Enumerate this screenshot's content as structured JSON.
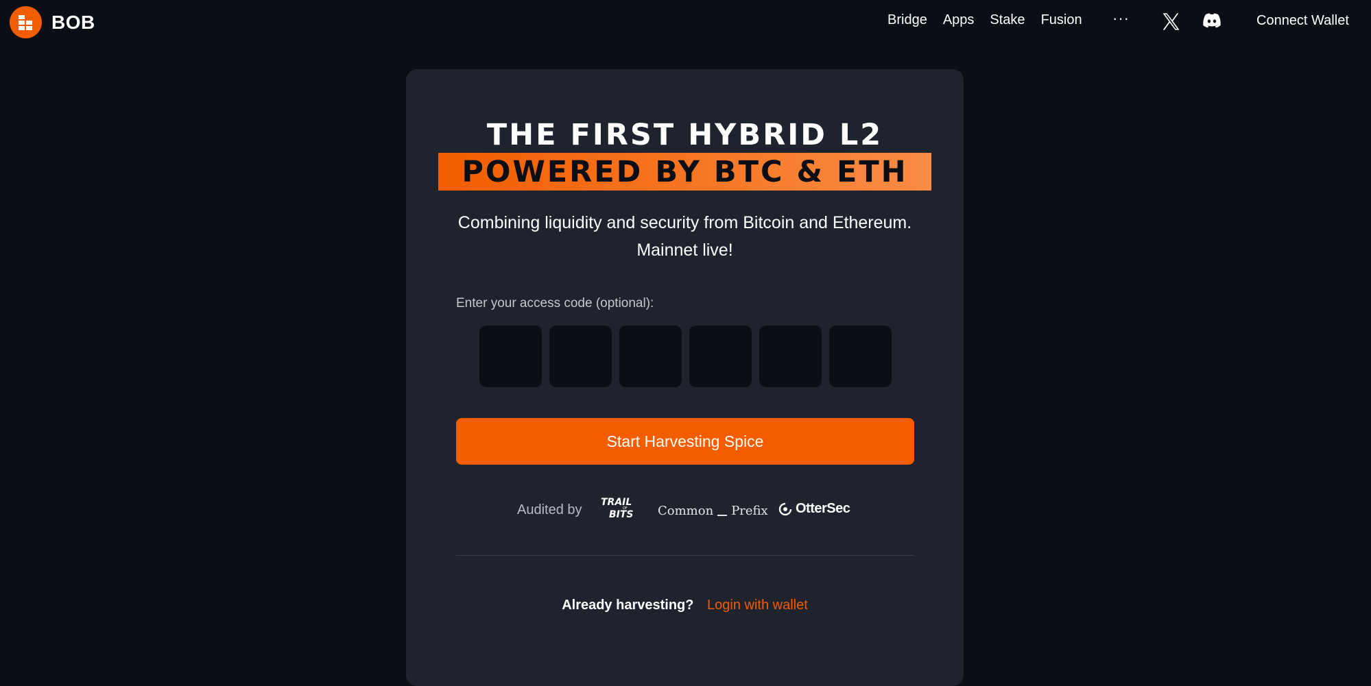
{
  "brand": {
    "name": "BOB"
  },
  "nav": {
    "items": [
      {
        "label": "Bridge"
      },
      {
        "label": "Apps"
      },
      {
        "label": "Stake"
      },
      {
        "label": "Fusion"
      }
    ],
    "more_label": "···",
    "connect_wallet_label": "Connect Wallet"
  },
  "hero": {
    "headline_line1": "THE FIRST HYBRID L2",
    "headline_line2": "POWERED BY BTC & ETH",
    "subtitle_line1": "Combining liquidity and security from Bitcoin and Ethereum.",
    "subtitle_line2": "Mainnet live!"
  },
  "access_code": {
    "label": "Enter your access code (optional):",
    "boxes": [
      "",
      "",
      "",
      "",
      "",
      ""
    ]
  },
  "cta": {
    "label": "Start Harvesting Spice"
  },
  "audits": {
    "label": "Audited by",
    "trail_of_bits": "TRAIL OF BITS",
    "common_prefix_left": "Common",
    "common_prefix_right": "Prefix",
    "ottersec": "OtterSec"
  },
  "login": {
    "prompt": "Already harvesting?",
    "link_label": "Login with wallet"
  },
  "colors": {
    "accent": "#f25d00",
    "background": "#0b0e14",
    "card": "#1f232e"
  },
  "icons": {
    "brand": "bob-logo-icon",
    "more": "more-icon",
    "x": "x-twitter-icon",
    "discord": "discord-icon",
    "ottersec": "ottersec-icon"
  }
}
